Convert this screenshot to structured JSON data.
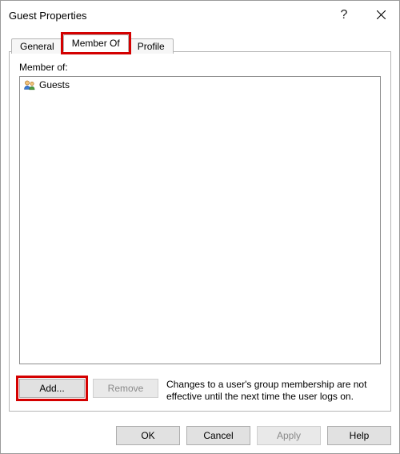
{
  "window": {
    "title": "Guest Properties"
  },
  "tabs": {
    "general": "General",
    "member_of": "Member Of",
    "profile": "Profile"
  },
  "panel": {
    "label": "Member of:",
    "items": [
      {
        "name": "Guests"
      }
    ],
    "add_label": "Add...",
    "remove_label": "Remove",
    "note": "Changes to a user's group membership are not effective until the next time the user logs on."
  },
  "buttons": {
    "ok": "OK",
    "cancel": "Cancel",
    "apply": "Apply",
    "help": "Help"
  }
}
